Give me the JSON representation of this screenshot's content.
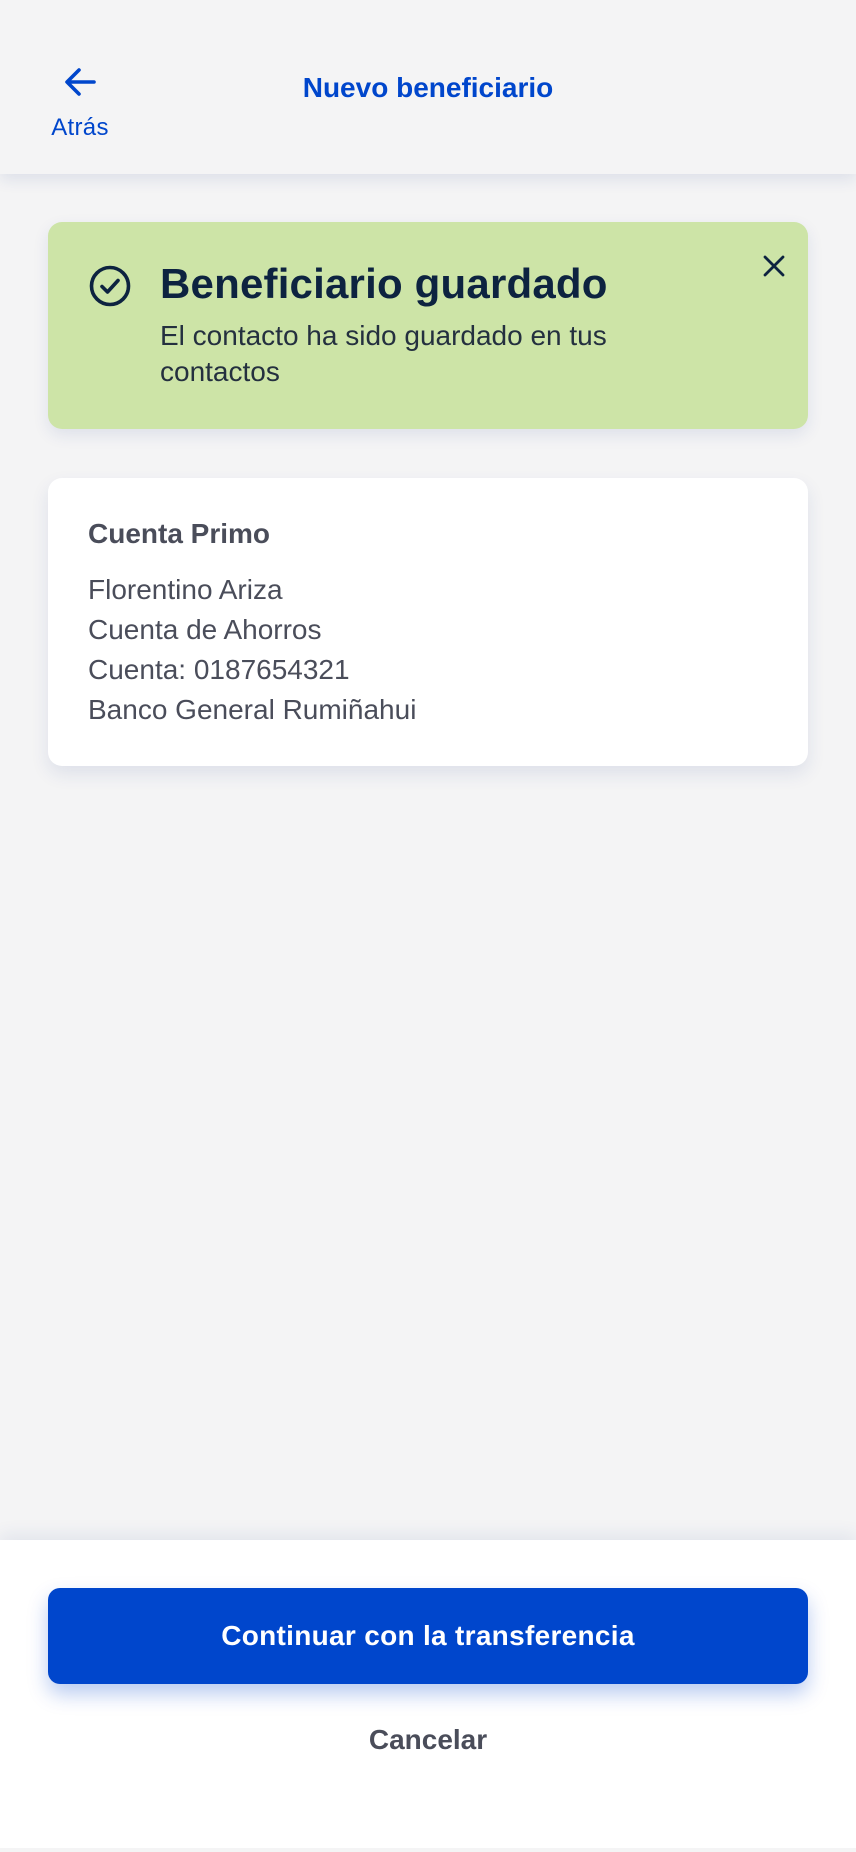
{
  "header": {
    "back_label": "Atrás",
    "title": "Nuevo beneficiario",
    "back_icon": "arrow-left-icon"
  },
  "toast": {
    "icon": "check-circle-icon",
    "title": "Beneficiario guardado",
    "message": "El contacto ha sido guardado en tus contactos",
    "close_icon": "close-icon"
  },
  "beneficiary": {
    "alias": "Cuenta Primo",
    "name": "Florentino Ariza",
    "account_type": "Cuenta de Ahorros",
    "account_number": "Cuenta: 0187654321",
    "bank": "Banco General Rumiñahui"
  },
  "actions": {
    "primary_label": "Continuar con la transferencia",
    "cancel_label": "Cancelar"
  },
  "colors": {
    "brand": "#0046cc",
    "success_bg": "#cde4a7",
    "background": "#f4f4f5",
    "text": "#4a4d5a"
  }
}
